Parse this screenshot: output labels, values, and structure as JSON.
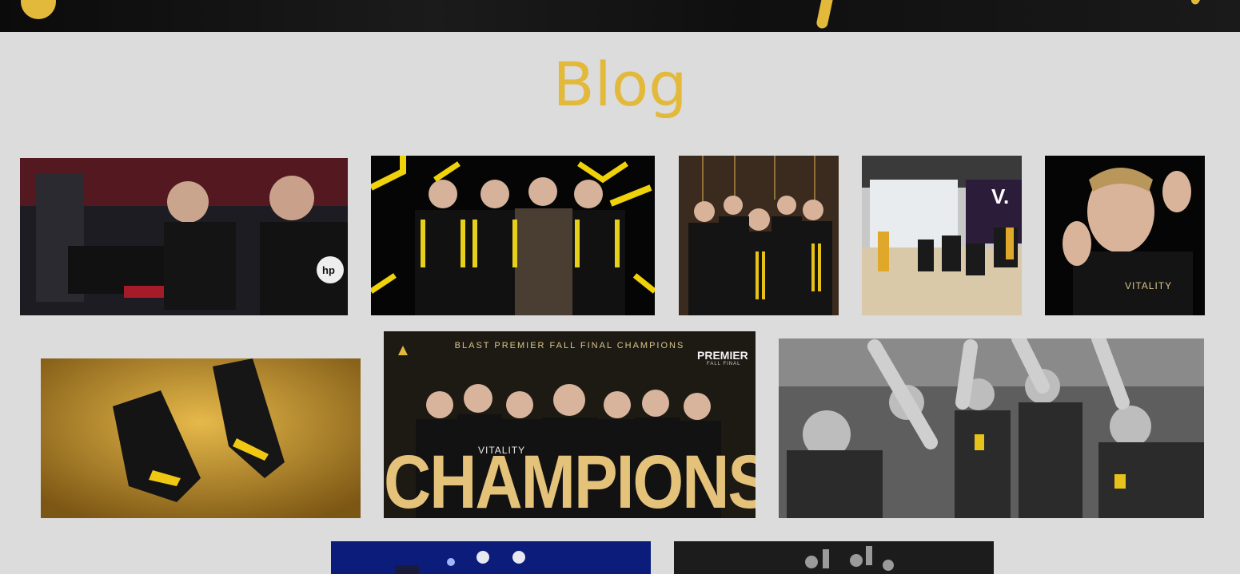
{
  "page": {
    "title": "Blog",
    "accent_color": "#e2b93b",
    "background_color": "#dcdcdc"
  },
  "gallery": {
    "photos": [
      {
        "subject": "players-at-pc-stage",
        "text": "hp"
      },
      {
        "subject": "team-lineup-neon",
        "text": ""
      },
      {
        "subject": "team-five-players",
        "text": ""
      },
      {
        "subject": "gaming-room",
        "text": "V."
      },
      {
        "subject": "player-portrait",
        "text": "VITALITY"
      },
      {
        "subject": "black-gold-sneakers",
        "text": ""
      },
      {
        "subject": "champions-poster",
        "text": "CHAMPIONS"
      },
      {
        "subject": "celebration-bw",
        "text": ""
      },
      {
        "subject": "stage-blue-lights",
        "text": ""
      },
      {
        "subject": "celebration-dark",
        "text": ""
      }
    ],
    "champions_poster": {
      "header": "BLAST PREMIER FALL FINAL CHAMPIONS",
      "premier_label": "PREMIER",
      "premier_sub": "FALL FINAL",
      "headline": "CHAMPIONS",
      "shirt": "VITALITY"
    }
  }
}
